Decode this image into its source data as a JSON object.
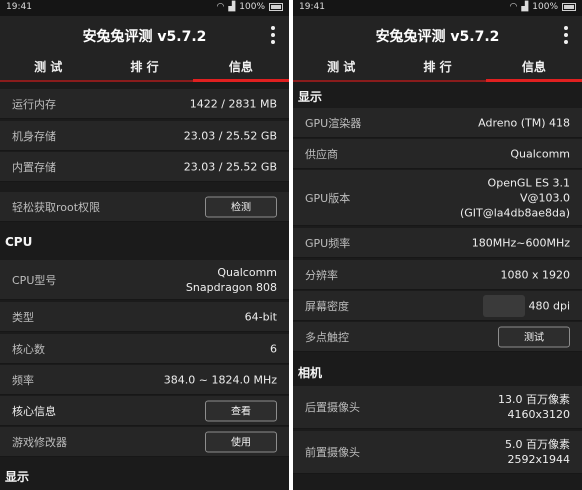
{
  "status": {
    "time": "19:41",
    "battery": "100%"
  },
  "app": {
    "title": "安兔兔评测 v5.7.2"
  },
  "tabs": [
    "测 试",
    "排 行",
    "信息"
  ],
  "left": {
    "memory": [
      {
        "label": "运行内存",
        "value": "1422 / 2831 MB"
      },
      {
        "label": "机身存储",
        "value": "23.03 / 25.52 GB"
      },
      {
        "label": "内置存储",
        "value": "23.03 / 25.52 GB"
      }
    ],
    "root": {
      "label": "轻松获取root权限",
      "button": "检测"
    },
    "cpu_section": "CPU",
    "cpu": [
      {
        "label": "CPU型号",
        "value": "Qualcomm\nSnapdragon 808"
      },
      {
        "label": "类型",
        "value": "64-bit"
      },
      {
        "label": "核心数",
        "value": "6"
      },
      {
        "label": "频率",
        "value": "384.0 ~ 1824.0 MHz"
      }
    ],
    "core_info": {
      "label": "核心信息",
      "button": "查看"
    },
    "game_mod": {
      "label": "游戏修改器",
      "button": "使用"
    },
    "display_section": "显示"
  },
  "right": {
    "display_section": "显示",
    "display": [
      {
        "label": "GPU渲染器",
        "value": "Adreno (TM) 418"
      },
      {
        "label": "供应商",
        "value": "Qualcomm"
      },
      {
        "label": "GPU版本",
        "value": "OpenGL ES 3.1\nV@103.0\n(GIT@la4db8ae8da)"
      },
      {
        "label": "GPU频率",
        "value": "180MHz~600MHz"
      },
      {
        "label": "分辨率",
        "value": "1080 x 1920"
      },
      {
        "label": "屏幕密度",
        "value": "480 dpi"
      }
    ],
    "multitouch": {
      "label": "多点触控",
      "button": "测试"
    },
    "camera_section": "相机",
    "camera": [
      {
        "label": "后置摄像头",
        "value": "13.0 百万像素\n4160x3120"
      },
      {
        "label": "前置摄像头",
        "value": "5.0 百万像素\n2592x1944"
      }
    ]
  }
}
